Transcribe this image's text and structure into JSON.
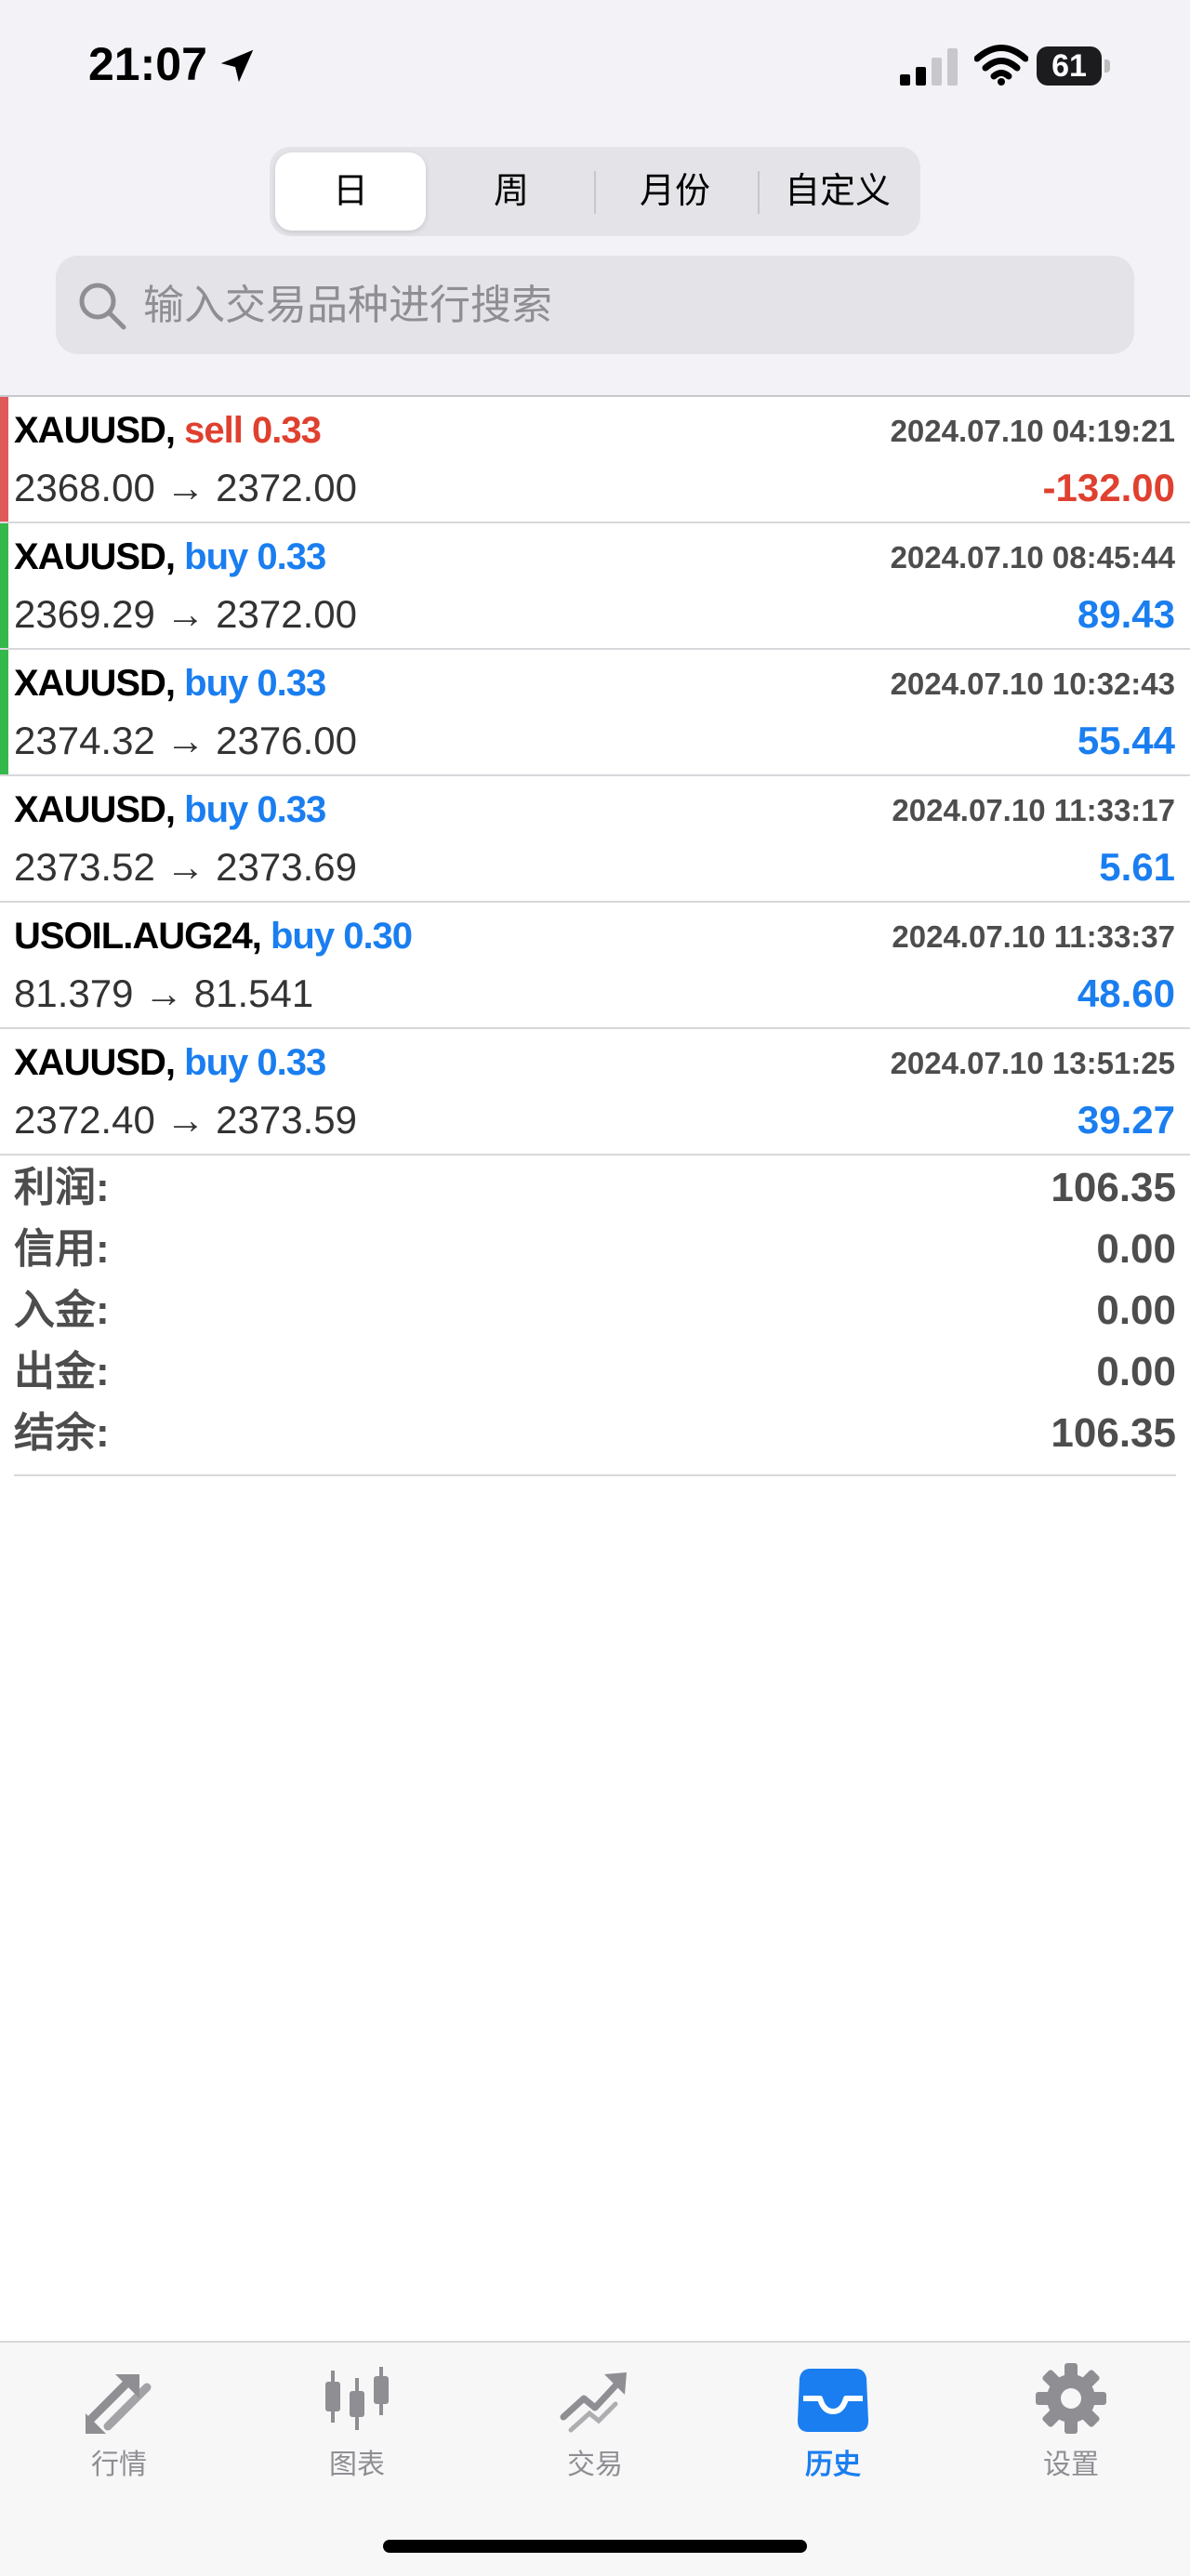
{
  "status_bar": {
    "time": "21:07",
    "battery": "61"
  },
  "segments": [
    {
      "label": "日",
      "active": true
    },
    {
      "label": "周",
      "active": false
    },
    {
      "label": "月份",
      "active": false
    },
    {
      "label": "自定义",
      "active": false
    }
  ],
  "search": {
    "placeholder": "输入交易品种进行搜索"
  },
  "trades": [
    {
      "symbol": "XAUUSD,",
      "type": "sell 0.33",
      "date": "2024.07.10 04:19:21",
      "prices": "2368.00 → 2372.00",
      "profit": "-132.00"
    },
    {
      "symbol": "XAUUSD,",
      "type": "buy 0.33",
      "date": "2024.07.10 08:45:44",
      "prices": "2369.29 → 2372.00",
      "profit": "89.43"
    },
    {
      "symbol": "XAUUSD,",
      "type": "buy 0.33",
      "date": "2024.07.10 10:32:43",
      "prices": "2374.32 → 2376.00",
      "profit": "55.44"
    },
    {
      "symbol": "XAUUSD,",
      "type": "buy 0.33",
      "date": "2024.07.10 11:33:17",
      "prices": "2373.52 → 2373.69",
      "profit": "5.61"
    },
    {
      "symbol": "USOIL.AUG24,",
      "type": "buy 0.30",
      "date": "2024.07.10 11:33:37",
      "prices": "81.379 → 81.541",
      "profit": "48.60"
    },
    {
      "symbol": "XAUUSD,",
      "type": "buy 0.33",
      "date": "2024.07.10 13:51:25",
      "prices": "2372.40 → 2373.59",
      "profit": "39.27"
    }
  ],
  "summary": [
    {
      "label": "利润:",
      "value": "106.35"
    },
    {
      "label": "信用:",
      "value": "0.00"
    },
    {
      "label": "入金:",
      "value": "0.00"
    },
    {
      "label": "出金:",
      "value": "0.00"
    },
    {
      "label": "结余:",
      "value": "106.35"
    }
  ],
  "tabs": [
    {
      "label": "行情",
      "icon": "quotes-arrows-icon"
    },
    {
      "label": "图表",
      "icon": "candlestick-chart-icon"
    },
    {
      "label": "交易",
      "icon": "trade-trend-icon"
    },
    {
      "label": "历史",
      "icon": "history-inbox-icon"
    },
    {
      "label": "设置",
      "icon": "settings-gear-icon"
    }
  ],
  "colors": {
    "sell": "#e0402f",
    "buy": "#1a7ef0",
    "bar_red": "#e05a5a",
    "bar_green": "#35b84a",
    "active_tab": "#1a7ef0",
    "inactive_tab": "#8e8e93"
  }
}
